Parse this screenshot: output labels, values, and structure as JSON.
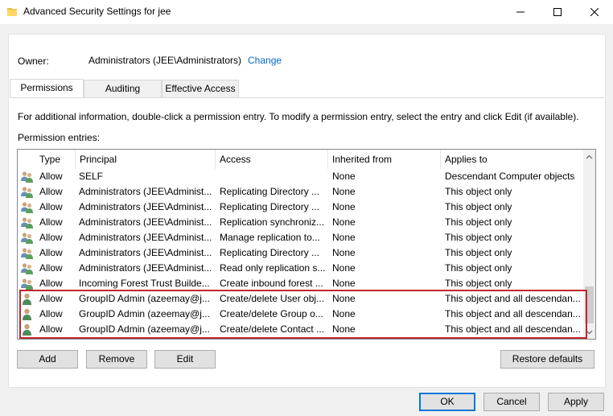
{
  "window": {
    "title": "Advanced Security Settings for jee"
  },
  "owner": {
    "label": "Owner:",
    "value": "Administrators (JEE\\Administrators)",
    "change_link": "Change"
  },
  "tabs": [
    {
      "label": "Permissions",
      "active": true
    },
    {
      "label": "Auditing",
      "active": false
    },
    {
      "label": "Effective Access",
      "active": false
    }
  ],
  "info_text": "For additional information, double-click a permission entry. To modify a permission entry, select the entry and click Edit (if available).",
  "entries_label": "Permission entries:",
  "columns": {
    "type": "Type",
    "principal": "Principal",
    "access": "Access",
    "inherited": "Inherited from",
    "applies": "Applies to"
  },
  "rows": [
    {
      "icon": "group-icon",
      "type": "Allow",
      "principal": "SELF",
      "access": "",
      "inherited": "None",
      "applies": "Descendant Computer objects"
    },
    {
      "icon": "group-icon",
      "type": "Allow",
      "principal": "Administrators (JEE\\Administ...",
      "access": "Replicating Directory ...",
      "inherited": "None",
      "applies": "This object only"
    },
    {
      "icon": "group-icon",
      "type": "Allow",
      "principal": "Administrators (JEE\\Administ...",
      "access": "Replicating Directory ...",
      "inherited": "None",
      "applies": "This object only"
    },
    {
      "icon": "group-icon",
      "type": "Allow",
      "principal": "Administrators (JEE\\Administ...",
      "access": "Replication synchroniz...",
      "inherited": "None",
      "applies": "This object only"
    },
    {
      "icon": "group-icon",
      "type": "Allow",
      "principal": "Administrators (JEE\\Administ...",
      "access": "Manage replication to...",
      "inherited": "None",
      "applies": "This object only"
    },
    {
      "icon": "group-icon",
      "type": "Allow",
      "principal": "Administrators (JEE\\Administ...",
      "access": "Replicating Directory ...",
      "inherited": "None",
      "applies": "This object only"
    },
    {
      "icon": "group-icon",
      "type": "Allow",
      "principal": "Administrators (JEE\\Administ...",
      "access": "Read only replication s...",
      "inherited": "None",
      "applies": "This object only"
    },
    {
      "icon": "group-icon",
      "type": "Allow",
      "principal": "Incoming Forest Trust Builde...",
      "access": "Create inbound forest ...",
      "inherited": "None",
      "applies": "This object only"
    },
    {
      "icon": "user-icon",
      "type": "Allow",
      "principal": "GroupID Admin (azeemay@j...",
      "access": "Create/delete User obj...",
      "inherited": "None",
      "applies": "This object and all descendan..."
    },
    {
      "icon": "user-icon",
      "type": "Allow",
      "principal": "GroupID Admin (azeemay@j...",
      "access": "Create/delete Group o...",
      "inherited": "None",
      "applies": "This object and all descendan..."
    },
    {
      "icon": "user-icon",
      "type": "Allow",
      "principal": "GroupID Admin (azeemay@j...",
      "access": "Create/delete Contact ...",
      "inherited": "None",
      "applies": "This object and all descendan..."
    }
  ],
  "buttons": {
    "add": "Add",
    "remove": "Remove",
    "edit": "Edit",
    "restore": "Restore defaults",
    "ok": "OK",
    "cancel": "Cancel",
    "apply": "Apply"
  },
  "colors": {
    "highlight": "#c1272d",
    "link": "#0066cc",
    "accent": "#0078d7"
  }
}
